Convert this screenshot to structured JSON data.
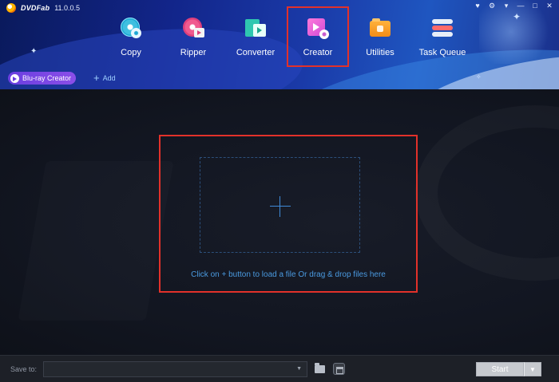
{
  "app": {
    "logo_text": "DVDFab",
    "version": "11.0.0.5",
    "window_controls": [
      "♥",
      "⚙",
      "▾",
      "—",
      "□",
      "✕"
    ]
  },
  "nav": {
    "items": [
      {
        "label": "Copy",
        "icon": "copy-disc-icon",
        "active": false
      },
      {
        "label": "Ripper",
        "icon": "ripper-disc-icon",
        "active": false
      },
      {
        "label": "Converter",
        "icon": "converter-clapper-icon",
        "active": false
      },
      {
        "label": "Creator",
        "icon": "creator-clapper-icon",
        "active": true
      },
      {
        "label": "Utilities",
        "icon": "utilities-toolbox-icon",
        "active": false
      },
      {
        "label": "Task Queue",
        "icon": "task-queue-icon",
        "active": false
      }
    ]
  },
  "subbar": {
    "mode_label": "Blu-ray Creator",
    "add_label": "Add"
  },
  "main": {
    "hint": "Click on + button to load a file Or drag & drop files here"
  },
  "footer": {
    "save_label": "Save to:",
    "path_value": "",
    "start_label": "Start"
  },
  "colors": {
    "highlight": "#e2312a",
    "accent_blue": "#4a9ae0",
    "mode_pill": "#7a46e4"
  }
}
